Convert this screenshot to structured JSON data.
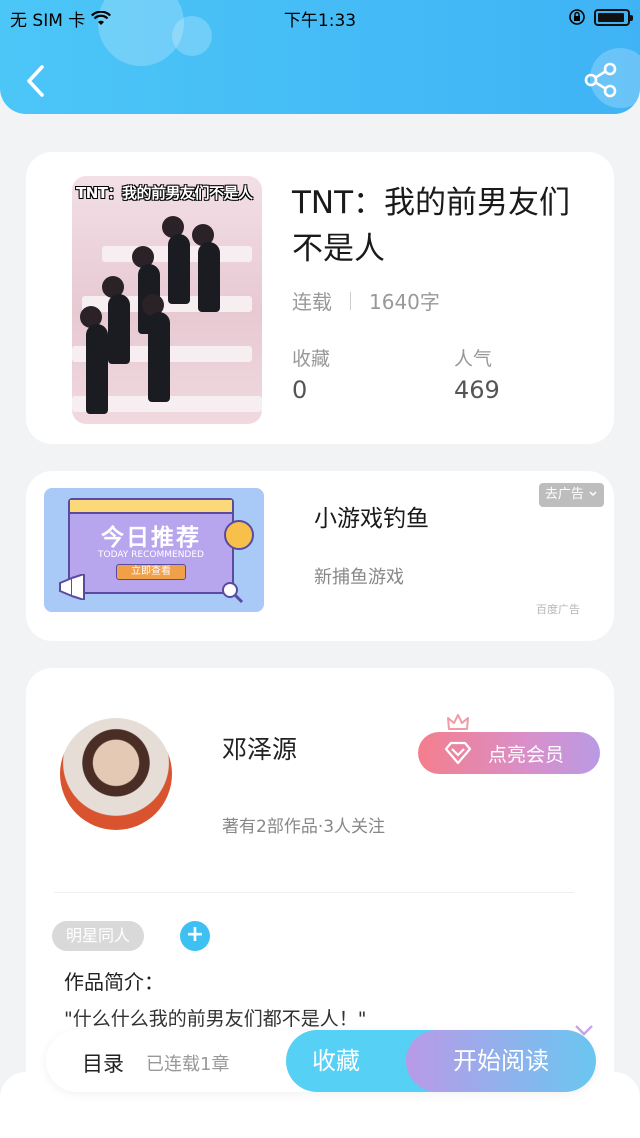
{
  "status_bar": {
    "carrier": "无 SIM 卡",
    "time": "下午1:33"
  },
  "header": {
    "back_icon": "chevron-left-icon",
    "share_icon": "share-icon"
  },
  "book": {
    "cover_caption": "TNT：我的前男友们不是人",
    "title": "TNT：我的前男友们不是人",
    "status": "连载",
    "word_count": "1640字",
    "favorites_label": "收藏",
    "favorites_value": "0",
    "popularity_label": "人气",
    "popularity_value": "469"
  },
  "ad": {
    "image_title": "今日推荐",
    "image_subtitle": "TODAY RECOMMENDED",
    "image_button": "立即查看",
    "title": "小游戏钓鱼",
    "subtitle": "新捕鱼游戏",
    "remove_label": "去广告",
    "source": "百度广告"
  },
  "author": {
    "name": "邓泽源",
    "stats": "著有2部作品·3人关注",
    "vip_label": "点亮会员",
    "tag": "明星同人",
    "tag_add": "+",
    "intro_label": "作品简介：",
    "intro_text": "\"什么什么我的前男友们都不是人！\""
  },
  "bottom_bar": {
    "toc_label": "目录",
    "toc_status": "已连载1章",
    "favorite_label": "收藏",
    "read_label": "开始阅读"
  },
  "colors": {
    "header_blue": "#3fb3f5",
    "accent_cyan": "#56d0f4",
    "vip_pink": "#f47e8c"
  }
}
